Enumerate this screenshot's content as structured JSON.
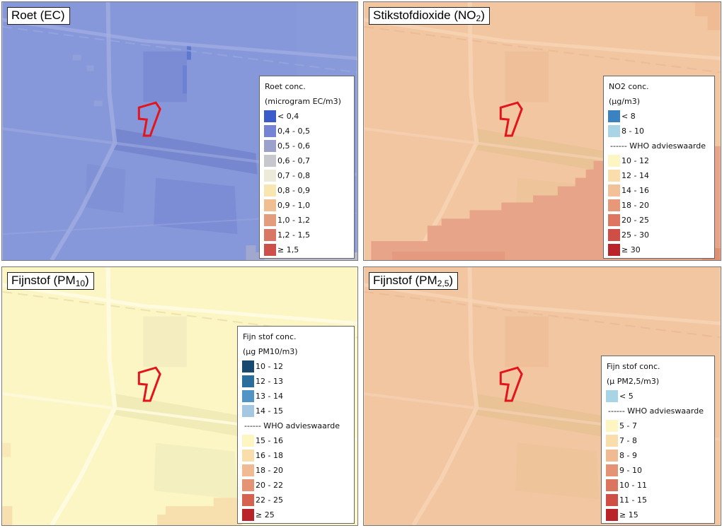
{
  "panels": {
    "ec": {
      "title": "Roet (EC)",
      "base_color": "#8798da",
      "legend": {
        "title": "Roet conc.",
        "unit": "(microgram EC/m3)",
        "classes": [
          {
            "label": "< 0,4",
            "color": "#3a5bc8"
          },
          {
            "label": "0,4 - 0,5",
            "color": "#7585d3"
          },
          {
            "label": "0,5 - 0,6",
            "color": "#9aa2cc"
          },
          {
            "label": "0,6 - 0,7",
            "color": "#c7c7ce"
          },
          {
            "label": "0,7 - 0,8",
            "color": "#ecebd9"
          },
          {
            "label": "0,8 - 0,9",
            "color": "#f7e6b1"
          },
          {
            "label": "0,9 - 1,0",
            "color": "#efbf91"
          },
          {
            "label": "1,0 - 1,2",
            "color": "#e39c7c"
          },
          {
            "label": "1,2 - 1,5",
            "color": "#d97766"
          },
          {
            "label": "≥ 1,5",
            "color": "#cc4f4a"
          }
        ]
      }
    },
    "no2": {
      "title_main": "Stikstofdioxide (NO",
      "title_sub": "2",
      "title_end": ")",
      "base_color": "#f2c6a1",
      "legend": {
        "title": "NO2 conc.",
        "unit": "(µg/m3)",
        "who": "------ WHO advieswaarde",
        "classes_below": [
          {
            "label": "< 8",
            "color": "#3b83c0"
          },
          {
            "label": "8 - 10",
            "color": "#a8d4e6"
          }
        ],
        "classes_above": [
          {
            "label": "10 - 12",
            "color": "#fdf6c3"
          },
          {
            "label": "12 - 14",
            "color": "#f9ddaa"
          },
          {
            "label": "14 - 16",
            "color": "#f3c197"
          },
          {
            "label": "18 - 20",
            "color": "#e69878"
          },
          {
            "label": "20 - 25",
            "color": "#dd7561"
          },
          {
            "label": "25 - 30",
            "color": "#cf4f47"
          },
          {
            "label": "≥ 30",
            "color": "#b9232a"
          }
        ]
      }
    },
    "pm10": {
      "title_main": "Fijnstof (PM",
      "title_sub": "10",
      "title_end": ")",
      "base_color": "#fcf6c5",
      "legend": {
        "title": "Fijn stof conc.",
        "unit": "(µg PM10/m3)",
        "who": "------ WHO advieswaarde",
        "classes_below": [
          {
            "label": "10 - 12",
            "color": "#174a6e"
          },
          {
            "label": "12 - 13",
            "color": "#2a6e9e"
          },
          {
            "label": "13 - 14",
            "color": "#5195c6"
          },
          {
            "label": "14 - 15",
            "color": "#a4c8e2"
          }
        ],
        "classes_above": [
          {
            "label": "15 - 16",
            "color": "#fdf6c3"
          },
          {
            "label": "16 - 18",
            "color": "#f9ddaa"
          },
          {
            "label": "18 - 20",
            "color": "#f0bb93"
          },
          {
            "label": "20 - 22",
            "color": "#e49474"
          },
          {
            "label": "22 - 25",
            "color": "#d5634f"
          },
          {
            "label": "≥ 25",
            "color": "#b9232a"
          }
        ]
      }
    },
    "pm25": {
      "title_main": "Fijnstof (PM",
      "title_sub": "2,5",
      "title_end": ")",
      "base_color": "#f2c6a1",
      "legend": {
        "title": "Fijn stof conc.",
        "unit": "(µ PM2,5/m3)",
        "who": "------ WHO advieswaarde",
        "classes_below": [
          {
            "label": "< 5",
            "color": "#a8d4e6"
          }
        ],
        "classes_above": [
          {
            "label": "5 - 7",
            "color": "#fdf6c3"
          },
          {
            "label": "7 - 8",
            "color": "#f9ddaa"
          },
          {
            "label": "8 - 9",
            "color": "#f0bb93"
          },
          {
            "label": "9 - 10",
            "color": "#e49474"
          },
          {
            "label": "10 - 11",
            "color": "#db7560"
          },
          {
            "label": "11 - 15",
            "color": "#cf4f47"
          },
          {
            "label": "≥ 15",
            "color": "#b9232a"
          }
        ]
      }
    }
  },
  "site_outline_color": "#e3141b"
}
